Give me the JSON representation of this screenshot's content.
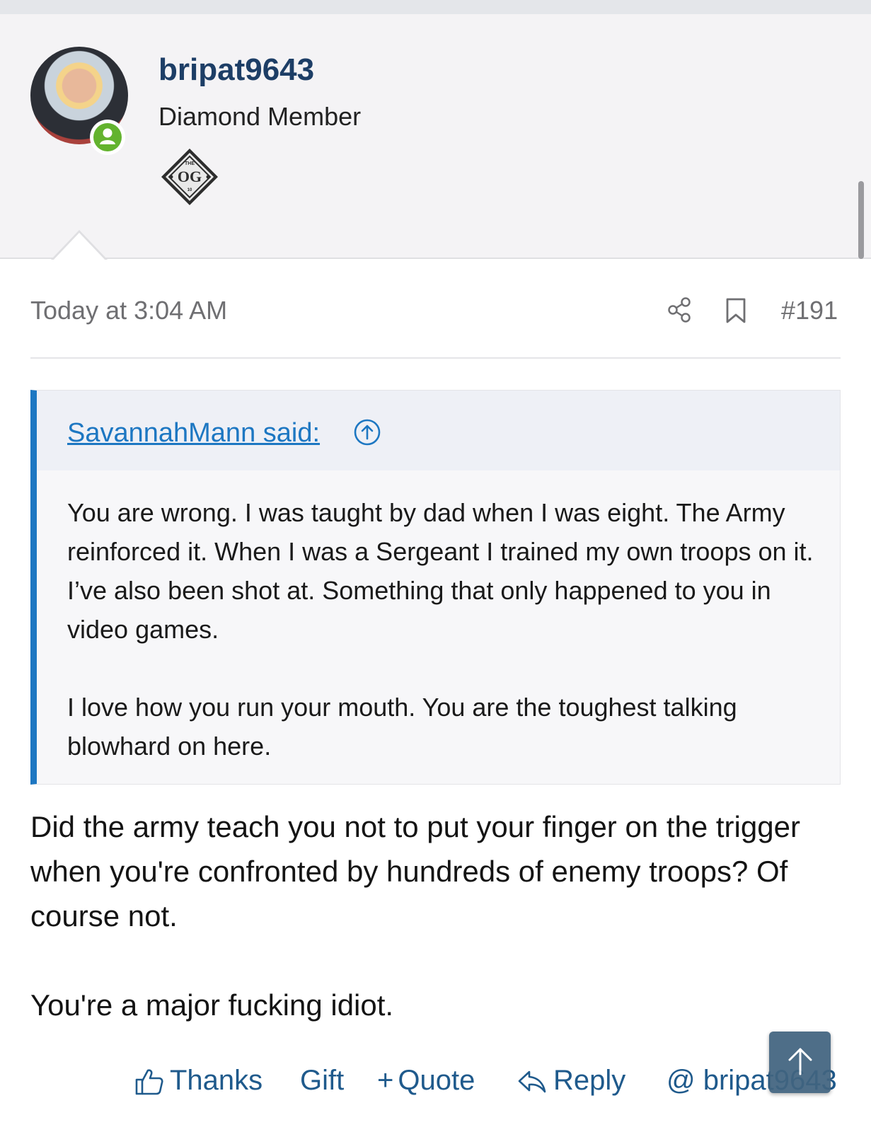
{
  "user": {
    "username": "bripat9643",
    "title": "Diamond Member",
    "trophy_text": "OG",
    "trophy_top_text": "THE",
    "trophy_bottom_text": "10"
  },
  "post": {
    "time": "Today at 3:04 AM",
    "number": "#191",
    "quote": {
      "author_label": "SavannahMann said:",
      "paragraphs": [
        "You are wrong. I was taught by dad when I was eight. The Army reinforced it. When I was a Sergeant I trained my own troops on it. I’ve also been shot at. Something that only happened to you in video games.",
        "I love how you run your mouth. You are the toughest talking blowhard on here."
      ]
    },
    "paragraphs": [
      "Did the army teach you not to put your finger on the trigger when you're confronted by hundreds of enemy troops? Of course not.",
      "You're a major fucking idiot."
    ]
  },
  "actions": {
    "thanks": "Thanks",
    "gift": "Gift",
    "quote_plus": "+",
    "quote": "Quote",
    "reply": "Reply",
    "mention": "@ bripat9643"
  },
  "icons": [
    "user-online-icon",
    "share-icon",
    "bookmark-icon",
    "arrow-up-circle-icon",
    "thumbs-up-icon",
    "reply-icon",
    "arrow-up-icon"
  ],
  "colors": {
    "link": "#1d77c2",
    "username": "#1d3e66",
    "action": "#1f5a8c",
    "online": "#63b32e",
    "quote_bar": "#1d77c2"
  }
}
